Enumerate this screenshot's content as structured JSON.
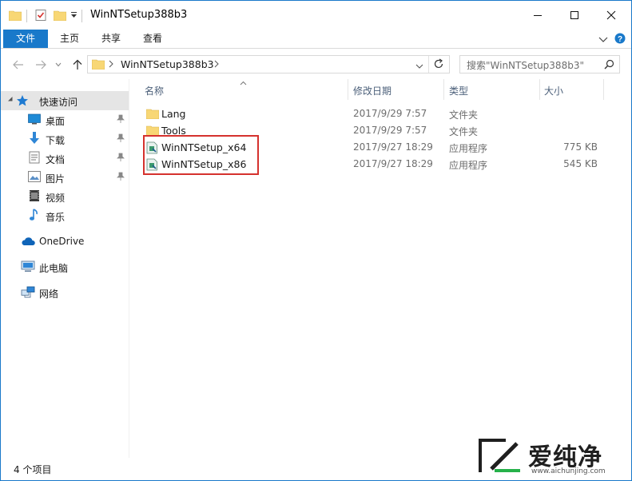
{
  "window": {
    "title": "WinNTSetup388b3"
  },
  "ribbon": {
    "tabs": [
      "文件",
      "主页",
      "共享",
      "查看"
    ]
  },
  "address": {
    "segments": [
      "WinNTSetup388b3"
    ]
  },
  "search": {
    "placeholder": "搜索\"WinNTSetup388b3\""
  },
  "nav": {
    "quick_access": "快速访问",
    "items": [
      {
        "label": "桌面",
        "pinned": true
      },
      {
        "label": "下载",
        "pinned": true
      },
      {
        "label": "文档",
        "pinned": true
      },
      {
        "label": "图片",
        "pinned": true
      },
      {
        "label": "视频",
        "pinned": false
      },
      {
        "label": "音乐",
        "pinned": false
      }
    ],
    "onedrive": "OneDrive",
    "this_pc": "此电脑",
    "network": "网络"
  },
  "columns": {
    "name": "名称",
    "date": "修改日期",
    "type": "类型",
    "size": "大小"
  },
  "files": [
    {
      "name": "Lang",
      "date": "2017/9/29 7:57",
      "type": "文件夹",
      "size": "",
      "icon": "folder-icon"
    },
    {
      "name": "Tools",
      "date": "2017/9/29 7:57",
      "type": "文件夹",
      "size": "",
      "icon": "folder-icon"
    },
    {
      "name": "WinNTSetup_x64",
      "date": "2017/9/27 18:29",
      "type": "应用程序",
      "size": "775 KB",
      "icon": "application-icon"
    },
    {
      "name": "WinNTSetup_x86",
      "date": "2017/9/27 18:29",
      "type": "应用程序",
      "size": "545 KB",
      "icon": "application-icon"
    }
  ],
  "status": {
    "text": "4 个项目"
  },
  "watermark": {
    "text": "爱纯净",
    "url": "www.aichunjing.com"
  },
  "colors": {
    "accent": "#1979ca",
    "highlight": "#d5322e",
    "folder": "#f8d775"
  }
}
